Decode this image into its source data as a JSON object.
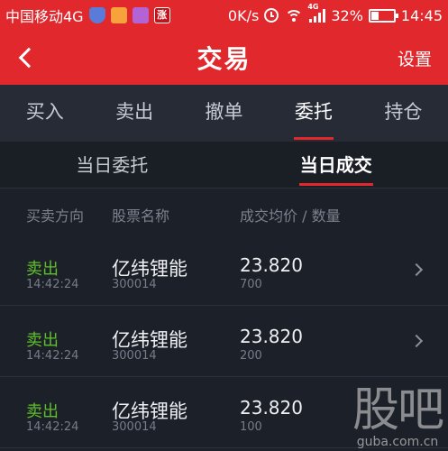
{
  "status_bar": {
    "carrier": "中国移动4G",
    "notif_badge": "涨",
    "speed": "0K/s",
    "signal_tag": "4G",
    "battery_percent": "32%",
    "battery_level": 0.32,
    "time": "14:45"
  },
  "header": {
    "title": "交易",
    "settings_label": "设置"
  },
  "main_tabs": [
    {
      "label": "买入"
    },
    {
      "label": "卖出"
    },
    {
      "label": "撤单"
    },
    {
      "label": "委托"
    },
    {
      "label": "持仓"
    }
  ],
  "main_tab_active": "委托",
  "sub_tabs": [
    {
      "label": "当日委托"
    },
    {
      "label": "当日成交"
    }
  ],
  "sub_tab_active": "当日成交",
  "columns": {
    "direction": "买卖方向",
    "stock_name": "股票名称",
    "price_qty": "成交均价 / 数量"
  },
  "rows": [
    {
      "direction": "卖出",
      "time": "14:42:24",
      "name": "亿纬锂能",
      "code": "300014",
      "price": "23.820",
      "quantity": "700"
    },
    {
      "direction": "卖出",
      "time": "14:42:24",
      "name": "亿纬锂能",
      "code": "300014",
      "price": "23.820",
      "quantity": "200"
    },
    {
      "direction": "卖出",
      "time": "14:42:24",
      "name": "亿纬锂能",
      "code": "300014",
      "price": "23.820",
      "quantity": "100"
    }
  ],
  "watermark": {
    "logo": "股吧",
    "site": "guba.com.cn"
  },
  "colors": {
    "brand_red": "#e0282d",
    "sell_green": "#5fbf2a",
    "background": "#1c2028"
  }
}
